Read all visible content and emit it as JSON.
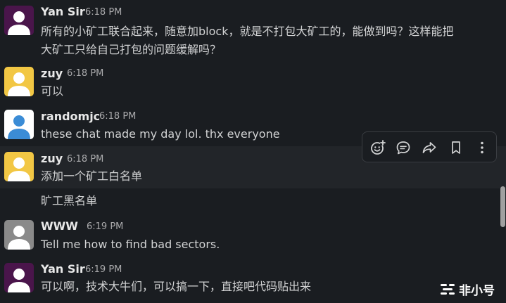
{
  "colors": {
    "background": "#1a1d21",
    "hover_row": "#222529",
    "avatar_purple": "#4a154b",
    "avatar_yellow": "#f2c744",
    "avatar_blue": "#3b8cd6",
    "avatar_gray": "#8a8a8a"
  },
  "messages": [
    {
      "author": "Yan Sir",
      "time": "6:18 PM",
      "avatar_icon": "default-user-icon",
      "avatar_color": "#4a154b",
      "lines": [
        "所有的小矿工联合起来，随意加block，就是不打包大矿工的，能做到吗？这样能把",
        "大矿工只给自己打包的问题缓解吗？"
      ]
    },
    {
      "author": "zuy",
      "time": "6:18 PM",
      "avatar_icon": "default-user-icon",
      "avatar_color": "#f2c744",
      "lines": [
        "可以"
      ]
    },
    {
      "author": "randomjc",
      "time": "6:18 PM",
      "avatar_icon": "default-user-icon",
      "avatar_color": "#3b8cd6",
      "lines": [
        "these chat made my day lol. thx everyone"
      ]
    },
    {
      "author": "zuy",
      "time": "6:18 PM",
      "avatar_icon": "default-user-icon",
      "avatar_color": "#f2c744",
      "lines": [
        "添加一个矿工白名单"
      ]
    },
    {
      "continuation": true,
      "lines": [
        "旷工黑名单"
      ]
    },
    {
      "author": "WWW",
      "time": "6:19 PM",
      "avatar_icon": "default-user-icon",
      "avatar_color": "#8a8a8a",
      "lines": [
        "Tell me how to find bad sectors."
      ]
    },
    {
      "author": "Yan Sir",
      "time": "6:19 PM",
      "avatar_icon": "default-user-icon",
      "avatar_color": "#4a154b",
      "lines": [
        "可以啊，技术大牛们，可以搞一下，直接吧代码贴出来"
      ]
    }
  ],
  "toolbar": {
    "buttons": [
      {
        "icon": "add-reaction-icon"
      },
      {
        "icon": "reply-in-thread-icon"
      },
      {
        "icon": "share-message-icon"
      },
      {
        "icon": "bookmark-icon"
      },
      {
        "icon": "more-actions-icon"
      }
    ]
  },
  "watermark": {
    "text": "非小号"
  }
}
